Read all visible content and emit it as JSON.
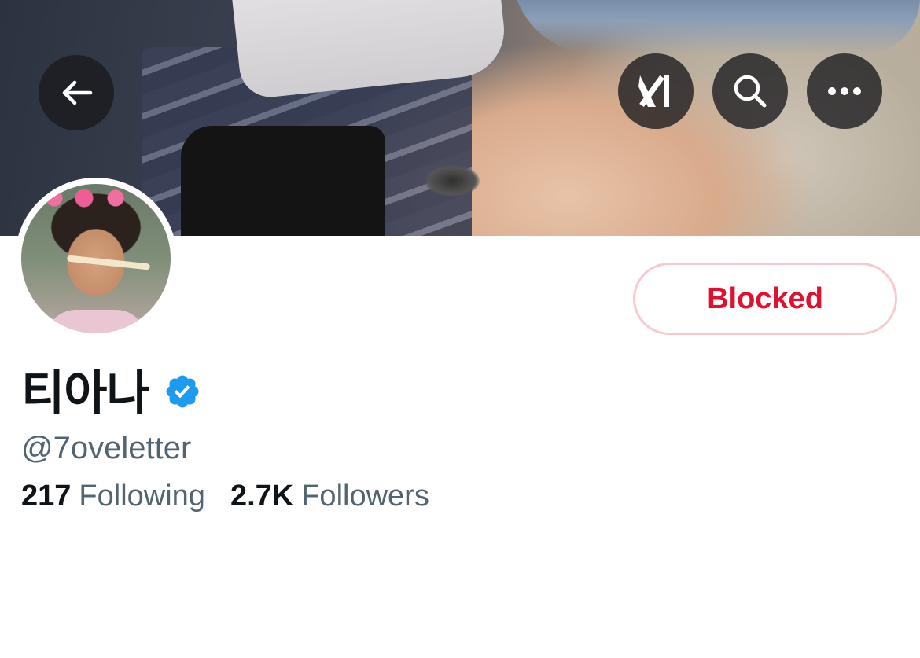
{
  "profile": {
    "display_name": "티아나",
    "verified": true,
    "handle": "@7oveletter",
    "blocked_label": "Blocked"
  },
  "stats": {
    "following_count": "217",
    "following_label": "Following",
    "followers_count": "2.7K",
    "followers_label": "Followers"
  },
  "header_buttons": {
    "back_icon": "arrow-left-icon",
    "grok_icon": "grok-icon",
    "search_icon": "search-icon",
    "more_icon": "more-horizontal-icon"
  },
  "colors": {
    "blocked_text": "#e0102e",
    "blocked_border": "#f8c9cf",
    "verified_badge": "#1d9bf0",
    "secondary_text": "#536471",
    "primary_text": "#0f1419"
  }
}
